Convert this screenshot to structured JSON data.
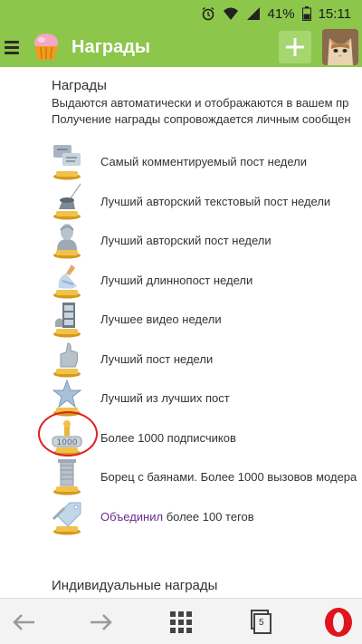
{
  "status": {
    "battery": "41%",
    "time": "15:11",
    "icons": [
      "alarm-icon",
      "wifi-icon",
      "signal-icon",
      "battery-icon"
    ]
  },
  "header": {
    "title": "Награды",
    "add_icon": "plus-icon"
  },
  "main": {
    "section_title": "Награды",
    "desc1": "Выдаются автоматически и отображаются в вашем пр",
    "desc2": "Получение награды сопровождается личным сообщен",
    "awards": [
      {
        "label": "Самый комментируемый пост недели",
        "icon": "comments-trophy-icon"
      },
      {
        "label": "Лучший авторский текстовый пост недели",
        "icon": "quill-trophy-icon"
      },
      {
        "label": "Лучший авторский пост недели",
        "icon": "bust-trophy-icon"
      },
      {
        "label": "Лучший длиннопост недели",
        "icon": "longpost-trophy-icon"
      },
      {
        "label": "Лучшее видео недели",
        "icon": "film-trophy-icon"
      },
      {
        "label": "Лучший пост недели",
        "icon": "thumbs-up-trophy-icon"
      },
      {
        "label": "Лучший из лучших пост",
        "icon": "star-trophy-icon"
      },
      {
        "label": "Более 1000 подписчиков",
        "icon": "1000-trophy-icon"
      },
      {
        "label": "Борец с баянами. Более 1000 вызовов модера",
        "icon": "accordion-trophy-icon"
      },
      {
        "label_link": "Объединил",
        "label_rest": " более 100 тегов",
        "icon": "tag-trophy-icon"
      }
    ],
    "individual_title": "Индивидуальные награды"
  },
  "browser": {
    "tabs_count": "5",
    "icons": [
      "back-arrow-icon",
      "forward-arrow-icon",
      "speed-dial-grid-icon",
      "tabs-icon",
      "opera-icon"
    ]
  },
  "colors": {
    "accent_green": "#8cc64b",
    "highlight_red": "#e02020",
    "link_purple": "#6a2d8a"
  }
}
